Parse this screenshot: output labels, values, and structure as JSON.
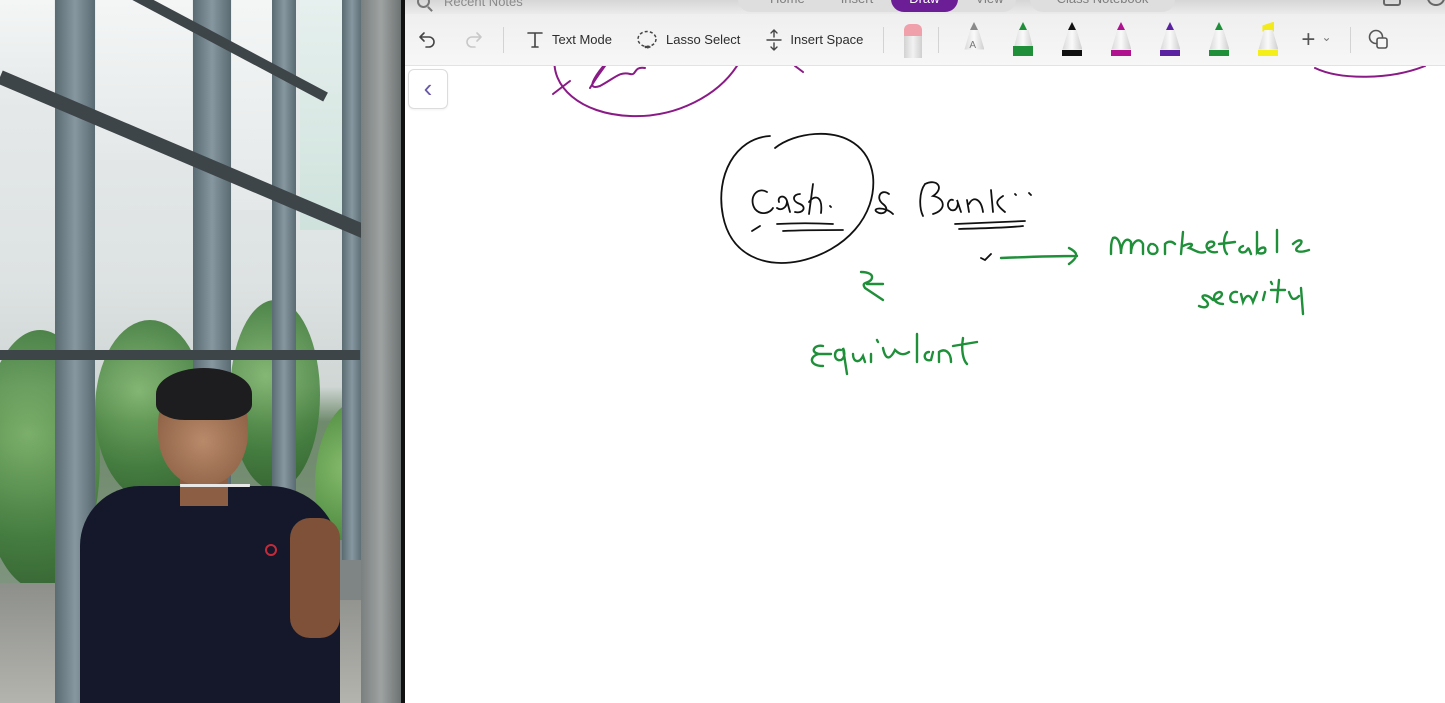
{
  "webcam": {
    "description": "Presenter webcam feed",
    "label": "presenter"
  },
  "app": {
    "search": {
      "placeholder": "Recent Notes",
      "icon": "search-icon"
    },
    "tabs": [
      {
        "label": "Home",
        "active": false
      },
      {
        "label": "Insert",
        "active": false
      },
      {
        "label": "Draw",
        "active": true
      },
      {
        "label": "View",
        "active": false
      }
    ],
    "extra_tab": {
      "label": "Class Notebook"
    },
    "accent_color": "#6b1e96",
    "ribbon": {
      "undo": {
        "icon": "undo-icon"
      },
      "redo": {
        "icon": "redo-icon"
      },
      "text_mode": {
        "label": "Text Mode",
        "icon": "text-mode-icon"
      },
      "lasso_select": {
        "label": "Lasso Select",
        "icon": "lasso-icon"
      },
      "insert_space": {
        "label": "Insert Space",
        "icon": "insert-space-icon"
      },
      "eraser": {
        "icon": "eraser-icon",
        "color": "#f0a0ab"
      },
      "pens": [
        {
          "name": "ink-to-text-pen",
          "color": "#8a8a8a",
          "letter": "A"
        },
        {
          "name": "green-pen-selected",
          "color": "#1f8f3a"
        },
        {
          "name": "black-pen",
          "color": "#111111"
        },
        {
          "name": "magenta-pen",
          "color": "#b0128f"
        },
        {
          "name": "purple-pen",
          "color": "#5a22a0"
        },
        {
          "name": "green-pen",
          "color": "#1f8f3a"
        },
        {
          "name": "yellow-highlighter",
          "color": "#f4ee1a"
        }
      ],
      "add_pen": {
        "label": "+",
        "chevron": "⌄"
      },
      "shapes": {
        "icon": "shapes-icon"
      }
    },
    "canvas": {
      "back_button": {
        "icon": "chevron-left-icon",
        "glyph": "‹"
      },
      "handwriting": {
        "black": [
          "Cash.",
          "&",
          "Bank."
        ],
        "green": [
          "&",
          "Equivalant",
          "marketable",
          "security"
        ],
        "purple_partial": "partially visible circled note above"
      },
      "ink_colors": {
        "black": "#111111",
        "green": "#1f8f3a",
        "purple": "#8a1a86"
      }
    }
  }
}
